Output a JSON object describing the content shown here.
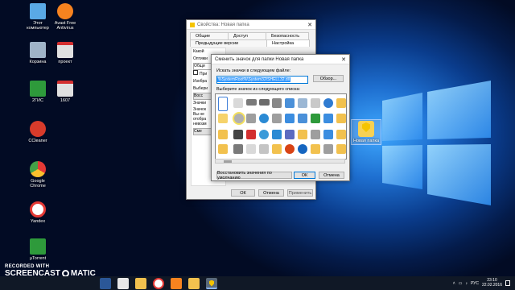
{
  "desktop": {
    "icons": [
      {
        "label": "Этот компьютер",
        "icon": "computer-icon",
        "color": "#5aa9e6"
      },
      {
        "label": "Avast Free Antivirus",
        "icon": "avast-icon",
        "color": "#f7831f"
      },
      {
        "label": "Корзина",
        "icon": "recycle-bin-icon",
        "color": "#9fb3c8"
      },
      {
        "label": "проект",
        "icon": "pdf-icon",
        "color": "#e0e0e0"
      },
      {
        "label": "2ГИС",
        "icon": "2gis-icon",
        "color": "#2e9a3b"
      },
      {
        "label": "1607",
        "icon": "pdf-icon",
        "color": "#e0e0e0"
      },
      {
        "label": "CCleaner",
        "icon": "ccleaner-icon",
        "color": "#d83b2b"
      },
      {
        "label": "Google Chrome",
        "icon": "chrome-icon",
        "color": "#4caf50"
      },
      {
        "label": "Yandex",
        "icon": "yandex-icon",
        "color": "#e53935"
      },
      {
        "label": "µTorrent",
        "icon": "utorrent-icon",
        "color": "#2e9a3b"
      }
    ],
    "folder_label": "Новая папка"
  },
  "properties_dialog": {
    "title": "Свойства: Новая папка",
    "tabs_row1": [
      "Общие",
      "Доступ",
      "Безопасность"
    ],
    "tabs_row2": [
      "Предыдущие версии",
      "Настройка"
    ],
    "fragments": [
      "Какой",
      "Оптими",
      "Общи",
      "При",
      "Изобра",
      "Выбери",
      "Восс",
      "Значки",
      "Значок",
      "Вы не",
      "отобра",
      "невозм",
      "Сме"
    ],
    "buttons": {
      "ok": "ОК",
      "cancel": "Отмена",
      "apply": "Применить"
    }
  },
  "change_icon_dialog": {
    "title": "Сменить значок для папки Новая папка",
    "search_label": "Искать значки в следующем файле:",
    "path_value": "%SystemRoot%\\System32\\SHELL32.dll",
    "browse_button": "Обзор...",
    "list_label": "Выберите значок из следующего списка:",
    "restore_button": "Восстановить значения по умолчанию",
    "ok_button": "ОК",
    "cancel_button": "Отмена"
  },
  "taskbar": {
    "language": "РУС",
    "time": "23:10",
    "date": "22.02.2016"
  },
  "watermark": {
    "line1": "RECORDED WITH",
    "brand_left": "SCREENCAST",
    "brand_right": "MATIC"
  }
}
